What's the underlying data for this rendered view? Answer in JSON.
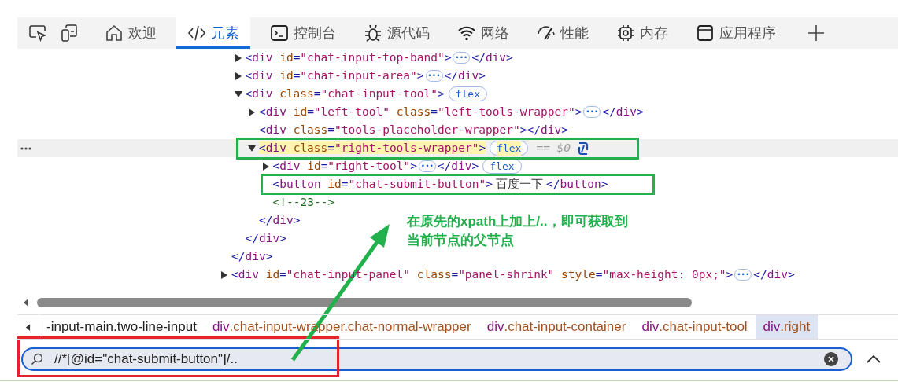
{
  "tabs": [
    {
      "selected": false
    },
    {
      "selected": false
    },
    {
      "label": "欢迎",
      "selected": false
    },
    {
      "label": "元素",
      "selected": true
    },
    {
      "label": "控制台",
      "selected": false
    },
    {
      "label": "源代码",
      "selected": false
    },
    {
      "label": "网络",
      "selected": false
    },
    {
      "label": "性能",
      "selected": false
    },
    {
      "label": "内存",
      "selected": false
    },
    {
      "label": "应用程序",
      "selected": false
    }
  ],
  "tree": [
    {
      "children": [
        {
          "expanded": false,
          "selected": false,
          "open": "<div id=\"chat-input-top-band\">",
          "ellipsis": "•••",
          "close": "</div>"
        },
        {
          "expanded": false,
          "selected": false,
          "open": "<div id=\"chat-input-area\">",
          "ellipsis": "•••",
          "close": "</div>"
        },
        {
          "expanded": true,
          "selected": false,
          "open": "<div class=\"chat-input-tool\">",
          "badge": "flex",
          "children": [
            {
              "expanded": false,
              "selected": false,
              "open": "<div id=\"left-tool\" class=\"left-tools-wrapper\">",
              "ellipsis": "•••",
              "close": "</div>"
            },
            {
              "selected": false,
              "open": "<div class=\"tools-placeholder-wrapper\"></div>"
            },
            {
              "expanded": true,
              "selected": true,
              "open": "<div class=\"right-tools-wrapper\">",
              "badge": "flex",
              "ref": "== $0",
              "children": [
                {
                  "expanded": false,
                  "selected": false,
                  "open": "<div id=\"right-tool\">",
                  "ellipsis": "•••",
                  "close": "</div>",
                  "badge": "flex"
                },
                {
                  "selected": false,
                  "open": "<button id=\"chat-submit-button\">",
                  "text": " 百度一下 ",
                  "close": "</button>"
                },
                {
                  "selected": false,
                  "open": "<!--23-->"
                }
              ],
              "closing": "</div>"
            }
          ],
          "closing": "</div>"
        }
      ],
      "closing": "</div>"
    },
    {
      "expanded": false,
      "selected": false,
      "open": "<div id=\"chat-input-panel\" class=\"panel-shrink\" style=\"max-height: 0px;\">",
      "ellipsis": "•••",
      "close": "</div>"
    }
  ],
  "breadcrumbs": [
    {
      "selected": false,
      "text": "-input-main.two-line-input"
    },
    {
      "selected": false,
      "tag": "div",
      "classes": ".chat-input-wrapper.chat-normal-wrapper"
    },
    {
      "selected": false,
      "tag": "div",
      "classes": ".chat-input-container"
    },
    {
      "selected": false,
      "tag": "div",
      "classes": ".chat-input-tool"
    },
    {
      "selected": true,
      "tag": "div",
      "classes": ".right"
    }
  ],
  "search": {
    "value": "//*[@id=\"chat-submit-button\"]/.."
  },
  "annotation": {
    "lines": [
      "在原先的xpath上加上/..，即可获取到",
      "当前节点的父节点"
    ]
  }
}
